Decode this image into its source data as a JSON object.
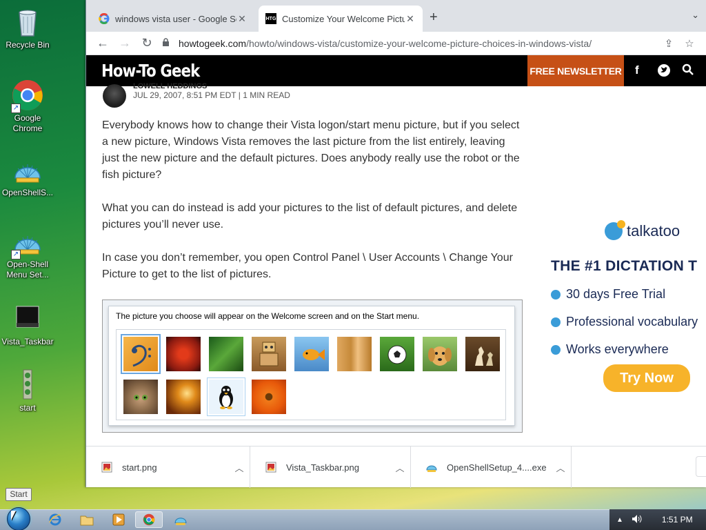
{
  "desktop": {
    "icons": [
      {
        "label": "Recycle Bin",
        "icon": "recycle-bin-icon"
      },
      {
        "label": "Google Chrome",
        "icon": "chrome-icon"
      },
      {
        "label": "OpenShellS...",
        "icon": "openshell-setup-icon"
      },
      {
        "label": "Open-Shell Menu Set...",
        "icon": "openshell-settings-icon"
      },
      {
        "label": "Vista_Taskbar",
        "icon": "image-file-icon"
      },
      {
        "label": "start",
        "icon": "image-file-icon"
      }
    ]
  },
  "browser": {
    "tabs": [
      {
        "title": "windows vista user - Google Sea",
        "favicon": "google-icon",
        "active": false
      },
      {
        "title": "Customize Your Welcome Picture",
        "favicon": "htg-icon",
        "favicon_text": "HTG",
        "active": true
      }
    ],
    "url_domain": "howtogeek.com",
    "url_path": "/howto/windows-vista/customize-your-welcome-picture-choices-in-windows-vista/"
  },
  "site": {
    "logo": "How-To Geek",
    "newsletter": "FREE NEWSLETTER",
    "author": "LOWELL HEDDINGS",
    "date": "JUL 29, 2007, 8:51 PM EDT | 1 MIN READ",
    "paragraphs": [
      "Everybody knows how to change their Vista logon/start menu picture, but if you select a new picture, Windows Vista removes the last picture from the list entirely, leaving just the new picture and the default pictures. Does anybody really use the robot or the fish picture?",
      "What you can do instead is add your pictures to the list of default pictures, and delete pictures you’ll never use.",
      "In case you don’t remember, you open Control Panel \\ User Accounts \\ Change Your Picture to get to the list of pictures."
    ],
    "screenshot_caption": "The picture you choose will appear on the Welcome screen and on the Start menu.",
    "pictures": [
      "bass clef",
      "starfish",
      "leaf",
      "robot",
      "fish",
      "bamboo",
      "soccer ball",
      "dog",
      "chess",
      "kitten",
      "sparkles",
      "penguin",
      "flower"
    ]
  },
  "ad": {
    "brand": "talkatoo",
    "headline": "THE #1 DICTATION T",
    "items": [
      "30 days Free Trial",
      "Professional vocabulary",
      "Works everywhere"
    ],
    "cta": "Try Now"
  },
  "downloads": [
    {
      "name": "start.png"
    },
    {
      "name": "Vista_Taskbar.png"
    },
    {
      "name": "OpenShellSetup_4....exe"
    }
  ],
  "taskbar": {
    "tooltip": "Start",
    "time": "1:51 PM"
  }
}
